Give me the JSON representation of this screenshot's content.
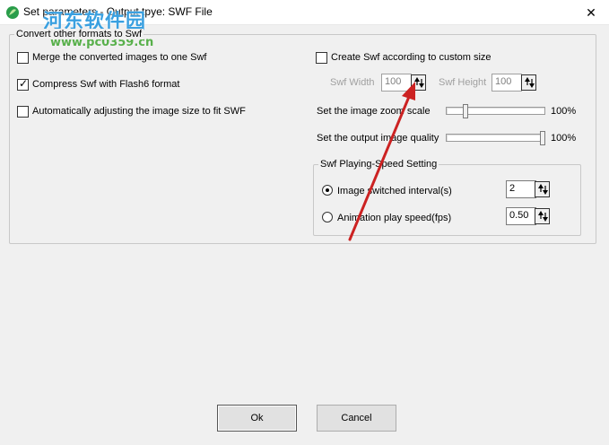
{
  "window": {
    "title": "Set parameters - Output tpye: SWF File",
    "close_glyph": "✕",
    "icon": "app-leaf-icon"
  },
  "watermark": {
    "text": "河东软件园",
    "url": "www.pc0359.cn"
  },
  "group": {
    "legend": "Convert other formats to Swf",
    "merge_label": "Merge the converted images to one Swf",
    "merge_checked": false,
    "compress_label": "Compress Swf with Flash6 format",
    "compress_checked": true,
    "auto_adjust_label": "Automatically adjusting the image size to fit SWF",
    "auto_adjust_checked": false,
    "custom_size_label": "Create Swf according to custom size",
    "custom_size_checked": false,
    "swf_width_label": "Swf Width",
    "swf_width_value": "100",
    "swf_height_label": "Swf Height",
    "swf_height_value": "100",
    "zoom_label": "Set the image zoom scale",
    "zoom_value": "100%",
    "zoom_fraction": 0.18,
    "quality_label": "Set the output image quality",
    "quality_value": "100%",
    "quality_fraction": 1.0
  },
  "speed": {
    "legend": "Swf Playing-Speed Setting",
    "interval_label": "Image switched interval(s)",
    "interval_value": "2",
    "interval_selected": true,
    "fps_label": "Animation play speed(fps)",
    "fps_value": "0.50",
    "fps_selected": false
  },
  "buttons": {
    "ok": "Ok",
    "cancel": "Cancel"
  },
  "colors": {
    "annotation_arrow": "#cc2222",
    "watermark_blue": "#3aa0e0",
    "watermark_green": "#58b04b"
  }
}
